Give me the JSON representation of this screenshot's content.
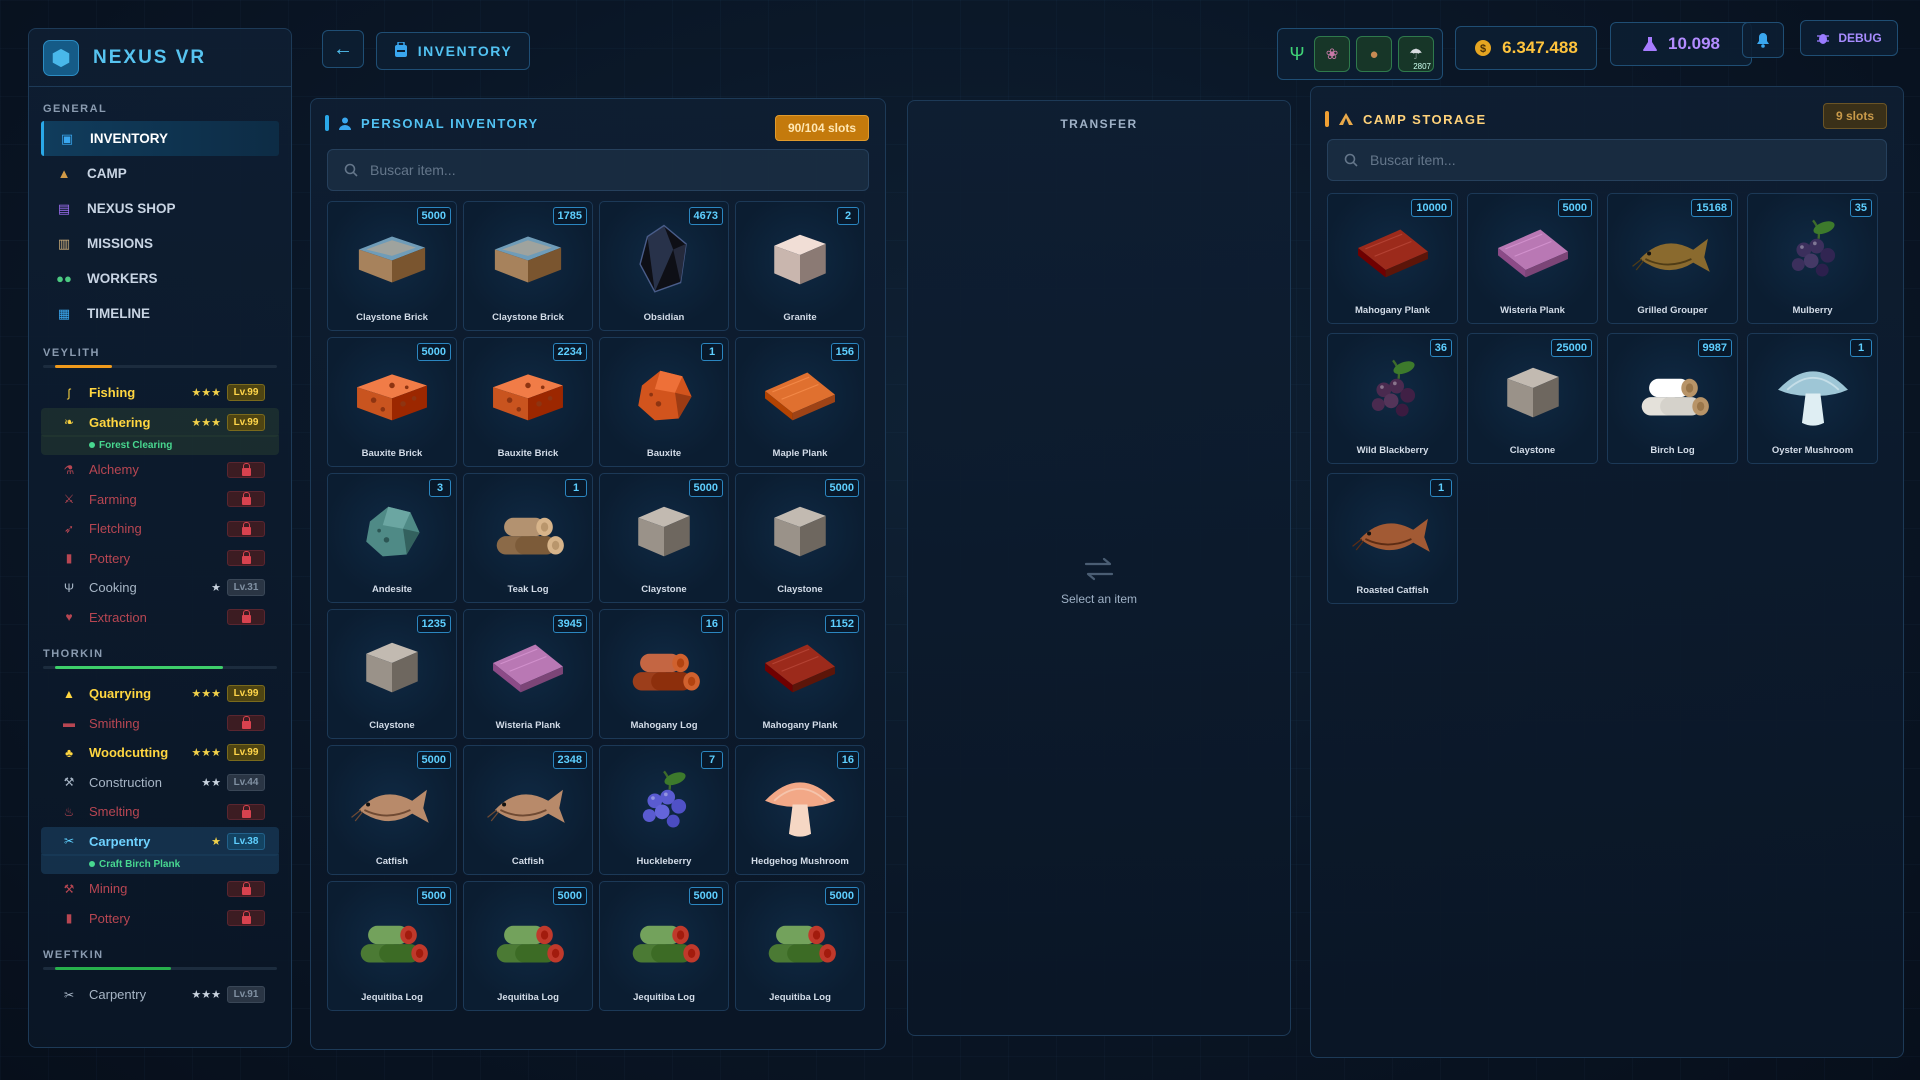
{
  "brand": {
    "name": "NEXUS VR",
    "icon": "hexagon-logo-icon"
  },
  "sidebar": {
    "general_label": "GENERAL",
    "nav": [
      {
        "label": "INVENTORY",
        "icon": "backpack-icon",
        "color": "#3aa7ef",
        "active": true
      },
      {
        "label": "CAMP",
        "icon": "tent-icon",
        "color": "#d19a47",
        "active": false
      },
      {
        "label": "NEXUS SHOP",
        "icon": "shop-icon",
        "color": "#9b6df0",
        "active": false
      },
      {
        "label": "MISSIONS",
        "icon": "clipboard-icon",
        "color": "#d1b07a",
        "active": false
      },
      {
        "label": "WORKERS",
        "icon": "people-icon",
        "color": "#4cc981",
        "active": false
      },
      {
        "label": "TIMELINE",
        "icon": "map-icon",
        "color": "#3aa7ef",
        "active": false
      }
    ],
    "sections": [
      {
        "label": "VEYLITH",
        "bar_color": "#f09a1c",
        "bar_fill": 0.27,
        "skills": [
          {
            "name": "Fishing",
            "icon": "fishing-hook-icon",
            "style": "gold",
            "stars": "★★★",
            "level": "Lv.99",
            "level_style": "gold"
          },
          {
            "name": "Gathering",
            "icon": "leaf-icon",
            "style": "gold hl",
            "stars": "★★★",
            "level": "Lv.99",
            "level_style": "gold",
            "task": "Forest Clearing",
            "task_bg": "greenbg"
          },
          {
            "name": "Alchemy",
            "icon": "flask-icon",
            "style": "locked",
            "locked": true
          },
          {
            "name": "Farming",
            "icon": "scythe-icon",
            "style": "locked",
            "locked": true
          },
          {
            "name": "Fletching",
            "icon": "bow-icon",
            "style": "locked",
            "locked": true
          },
          {
            "name": "Pottery",
            "icon": "vase-icon",
            "style": "locked",
            "locked": true
          },
          {
            "name": "Cooking",
            "icon": "fork-knife-icon",
            "style": "normal",
            "stars": "★",
            "level": "Lv.31",
            "level_style": "grey"
          },
          {
            "name": "Extraction",
            "icon": "heart-icon",
            "style": "locked",
            "locked": true
          }
        ]
      },
      {
        "label": "THORKIN",
        "bar_color": "#3ecf6a",
        "bar_fill": 0.8,
        "skills": [
          {
            "name": "Quarrying",
            "icon": "mountain-icon",
            "style": "gold",
            "stars": "★★★",
            "level": "Lv.99",
            "level_style": "gold"
          },
          {
            "name": "Smithing",
            "icon": "anvil-icon",
            "style": "locked",
            "locked": true
          },
          {
            "name": "Woodcutting",
            "icon": "tree-icon",
            "style": "gold",
            "stars": "★★★",
            "level": "Lv.99",
            "level_style": "gold"
          },
          {
            "name": "Construction",
            "icon": "hammer-icon",
            "style": "normal",
            "stars": "★★",
            "level": "Lv.44",
            "level_style": "grey"
          },
          {
            "name": "Smelting",
            "icon": "flame-icon",
            "style": "locked",
            "locked": true
          },
          {
            "name": "Carpentry",
            "icon": "saw-icon",
            "style": "blue hl-blue",
            "stars": "★",
            "level": "Lv.38",
            "level_style": "blue",
            "task": "Craft Birch Plank",
            "task_bg": "bluebg"
          },
          {
            "name": "Mining",
            "icon": "pickaxe-icon",
            "style": "locked",
            "locked": true
          },
          {
            "name": "Pottery",
            "icon": "vase-icon",
            "style": "locked",
            "locked": true
          }
        ]
      },
      {
        "label": "WEFTKIN",
        "bar_color": "#27b04c",
        "bar_fill": 0.55,
        "skills": [
          {
            "name": "Carpentry",
            "icon": "saw-icon",
            "style": "normal",
            "stars": "★★★",
            "level": "Lv.91",
            "level_style": "grey"
          }
        ]
      }
    ]
  },
  "topbar": {
    "inventory_tab": "INVENTORY",
    "food_slots": [
      {
        "icon": "fork-knife-icon",
        "qty": ""
      },
      {
        "icon": "berry-food-icon",
        "qty": ""
      },
      {
        "icon": "bread-food-icon",
        "qty": ""
      },
      {
        "icon": "mushroom-food-icon",
        "qty": "2807"
      }
    ],
    "coins": "6.347.488",
    "gems": "10.098",
    "debug_label": "DEBUG"
  },
  "personal": {
    "title": "PERSONAL INVENTORY",
    "slots": "90/104 slots",
    "search_placeholder": "Buscar item...",
    "items": [
      {
        "name": "Claystone Brick",
        "count": "5000",
        "art": "brick",
        "color": "#a7825c",
        "accent": "#6f9cb8"
      },
      {
        "name": "Claystone Brick",
        "count": "1785",
        "art": "brick",
        "color": "#a7825c",
        "accent": "#6f9cb8"
      },
      {
        "name": "Obsidian",
        "count": "4673",
        "art": "gem",
        "color": "#0e0f16",
        "accent": "#4a5d8a"
      },
      {
        "name": "Granite",
        "count": "2",
        "art": "cube",
        "color": "#c9b6ae",
        "accent": "#8b7a74"
      },
      {
        "name": "Bauxite Brick",
        "count": "5000",
        "art": "porous",
        "color": "#c9541f",
        "accent": "#8e3411"
      },
      {
        "name": "Bauxite Brick",
        "count": "2234",
        "art": "porous",
        "color": "#c9541f",
        "accent": "#8e3411"
      },
      {
        "name": "Bauxite",
        "count": "1",
        "art": "ore",
        "color": "#d2541d",
        "accent": "#8e3411"
      },
      {
        "name": "Maple Plank",
        "count": "156",
        "art": "plank",
        "color": "#e0702f",
        "accent": "#9e4316"
      },
      {
        "name": "Andesite",
        "count": "3",
        "art": "ore",
        "color": "#4f8a86",
        "accent": "#2c5654"
      },
      {
        "name": "Teak Log",
        "count": "1",
        "art": "logpile",
        "color": "#8b6a48",
        "accent": "#d7b48a"
      },
      {
        "name": "Claystone",
        "count": "5000",
        "art": "cube",
        "color": "#9a9289",
        "accent": "#6e675f"
      },
      {
        "name": "Claystone",
        "count": "5000",
        "art": "cube",
        "color": "#9a9289",
        "accent": "#6e675f"
      },
      {
        "name": "Claystone",
        "count": "1235",
        "art": "cube",
        "color": "#9a9289",
        "accent": "#6e675f"
      },
      {
        "name": "Wisteria Plank",
        "count": "3945",
        "art": "plank",
        "color": "#b978b4",
        "accent": "#7c4577"
      },
      {
        "name": "Mahogany Log",
        "count": "16",
        "art": "logpile",
        "color": "#9c3e1b",
        "accent": "#d0612e"
      },
      {
        "name": "Mahogany Plank",
        "count": "1152",
        "art": "plank",
        "color": "#9c2a1b",
        "accent": "#5c1509"
      },
      {
        "name": "Catfish",
        "count": "5000",
        "art": "fish",
        "color": "#b88a6a",
        "accent": "#6f4a33"
      },
      {
        "name": "Catfish",
        "count": "2348",
        "art": "fish",
        "color": "#b88a6a",
        "accent": "#6f4a33"
      },
      {
        "name": "Huckleberry",
        "count": "7",
        "art": "berries",
        "color": "#5a5bd0",
        "accent": "#2e2f8a"
      },
      {
        "name": "Hedgehog Mushroom",
        "count": "16",
        "art": "mushroom",
        "color": "#f2a887",
        "accent": "#f6d7c4"
      },
      {
        "name": "Jequitiba Log",
        "count": "5000",
        "art": "logpile",
        "color": "#4b7a34",
        "accent": "#c0392b"
      },
      {
        "name": "Jequitiba Log",
        "count": "5000",
        "art": "logpile",
        "color": "#4b7a34",
        "accent": "#c0392b"
      },
      {
        "name": "Jequitiba Log",
        "count": "5000",
        "art": "logpile",
        "color": "#4b7a34",
        "accent": "#c0392b"
      },
      {
        "name": "Jequitiba Log",
        "count": "5000",
        "art": "logpile",
        "color": "#4b7a34",
        "accent": "#c0392b"
      }
    ]
  },
  "transfer": {
    "title": "TRANSFER",
    "hint": "Select an item",
    "icon": "swap-arrows-icon"
  },
  "camp": {
    "title": "CAMP STORAGE",
    "slots": "9 slots",
    "search_placeholder": "Buscar item...",
    "items": [
      {
        "name": "Mahogany Plank",
        "count": "10000",
        "art": "plank",
        "color": "#9c2a1b",
        "accent": "#5c1509"
      },
      {
        "name": "Wisteria Plank",
        "count": "5000",
        "art": "plank",
        "color": "#b978b4",
        "accent": "#7c4577"
      },
      {
        "name": "Grilled Grouper",
        "count": "15168",
        "art": "fish",
        "color": "#8a6a2e",
        "accent": "#4f3c16"
      },
      {
        "name": "Mulberry",
        "count": "35",
        "art": "berries",
        "color": "#3b2f5c",
        "accent": "#1a1430"
      },
      {
        "name": "Wild Blackberry",
        "count": "36",
        "art": "berries",
        "color": "#4a2a4f",
        "accent": "#1f1024"
      },
      {
        "name": "Claystone",
        "count": "25000",
        "art": "cube",
        "color": "#9a9289",
        "accent": "#6e675f"
      },
      {
        "name": "Birch Log",
        "count": "9987",
        "art": "logpile",
        "color": "#e4e1da",
        "accent": "#b89468"
      },
      {
        "name": "Oyster Mushroom",
        "count": "1",
        "art": "mushroom",
        "color": "#9ec6d6",
        "accent": "#dfeef3"
      },
      {
        "name": "Roasted Catfish",
        "count": "1",
        "art": "fish",
        "color": "#a25a34",
        "accent": "#5c2c14"
      }
    ]
  },
  "colors": {
    "accent": "#2aa8e8",
    "gold": "#ffd640",
    "coin": "#ffc43d",
    "gem": "#b38cff",
    "locked": "#b84652"
  }
}
